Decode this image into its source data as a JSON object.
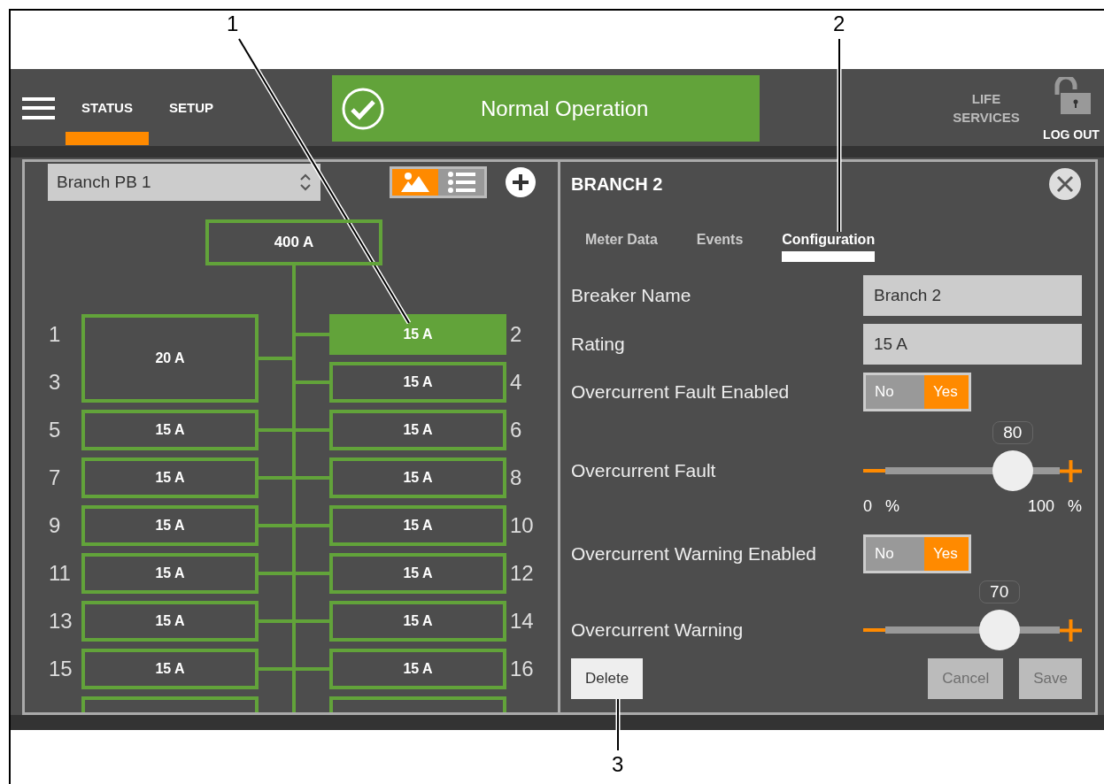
{
  "callouts": [
    {
      "label": "1"
    },
    {
      "label": "2"
    },
    {
      "label": "3"
    }
  ],
  "header": {
    "tabs": [
      {
        "label": "STATUS",
        "selected": true
      },
      {
        "label": "SETUP",
        "selected": false
      }
    ],
    "status": {
      "text": "Normal Operation"
    },
    "life_services": "LIFE SERVICES",
    "logout": "LOG OUT"
  },
  "panel_select": {
    "value": "Branch PB 1"
  },
  "view_toggle": [
    {
      "kind": "diagram",
      "selected": true
    },
    {
      "kind": "list",
      "selected": false
    }
  ],
  "main_breaker": {
    "label": "400 A"
  },
  "breakers_left": [
    {
      "label": "20 A",
      "positions": [
        "1",
        "3"
      ],
      "selected": false
    },
    {
      "label": "15 A",
      "positions": [
        "5"
      ],
      "selected": false
    },
    {
      "label": "15 A",
      "positions": [
        "7"
      ],
      "selected": false
    },
    {
      "label": "15 A",
      "positions": [
        "9"
      ],
      "selected": false
    },
    {
      "label": "15 A",
      "positions": [
        "11"
      ],
      "selected": false
    },
    {
      "label": "15 A",
      "positions": [
        "13"
      ],
      "selected": false
    },
    {
      "label": "15 A",
      "positions": [
        "15"
      ],
      "selected": false
    }
  ],
  "breakers_right": [
    {
      "label": "15 A",
      "positions": [
        "2"
      ],
      "selected": true
    },
    {
      "label": "15 A",
      "positions": [
        "4"
      ],
      "selected": false
    },
    {
      "label": "15 A",
      "positions": [
        "6"
      ],
      "selected": false
    },
    {
      "label": "15 A",
      "positions": [
        "8"
      ],
      "selected": false
    },
    {
      "label": "15 A",
      "positions": [
        "10"
      ],
      "selected": false
    },
    {
      "label": "15 A",
      "positions": [
        "12"
      ],
      "selected": false
    },
    {
      "label": "15 A",
      "positions": [
        "14"
      ],
      "selected": false
    },
    {
      "label": "15 A",
      "positions": [
        "16"
      ],
      "selected": false
    }
  ],
  "more_rows_below": true,
  "detail": {
    "title": "BRANCH 2",
    "tabs": [
      {
        "label": "Meter Data",
        "selected": false
      },
      {
        "label": "Events",
        "selected": false
      },
      {
        "label": "Configuration",
        "selected": true
      }
    ],
    "fields": [
      {
        "kind": "text",
        "label": "Breaker Name",
        "value": "Branch 2"
      },
      {
        "kind": "text",
        "label": "Rating",
        "value": "15 A"
      },
      {
        "kind": "toggle",
        "label": "Overcurrent Fault Enabled",
        "off_label": "No",
        "on_label": "Yes",
        "on": true
      },
      {
        "kind": "slider",
        "label": "Overcurrent Fault",
        "value": "80",
        "level": 0.8,
        "min_label": "0 %",
        "max_label": "100 %"
      },
      {
        "kind": "toggle",
        "label": "Overcurrent Warning Enabled",
        "off_label": "No",
        "on_label": "Yes",
        "on": true
      },
      {
        "kind": "slider",
        "label": "Overcurrent Warning",
        "value": "70",
        "level": 0.7
      }
    ],
    "buttons": [
      {
        "label": "Delete",
        "disabled": false
      },
      {
        "label": "Cancel",
        "disabled": true
      },
      {
        "label": "Save",
        "disabled": true
      }
    ]
  }
}
